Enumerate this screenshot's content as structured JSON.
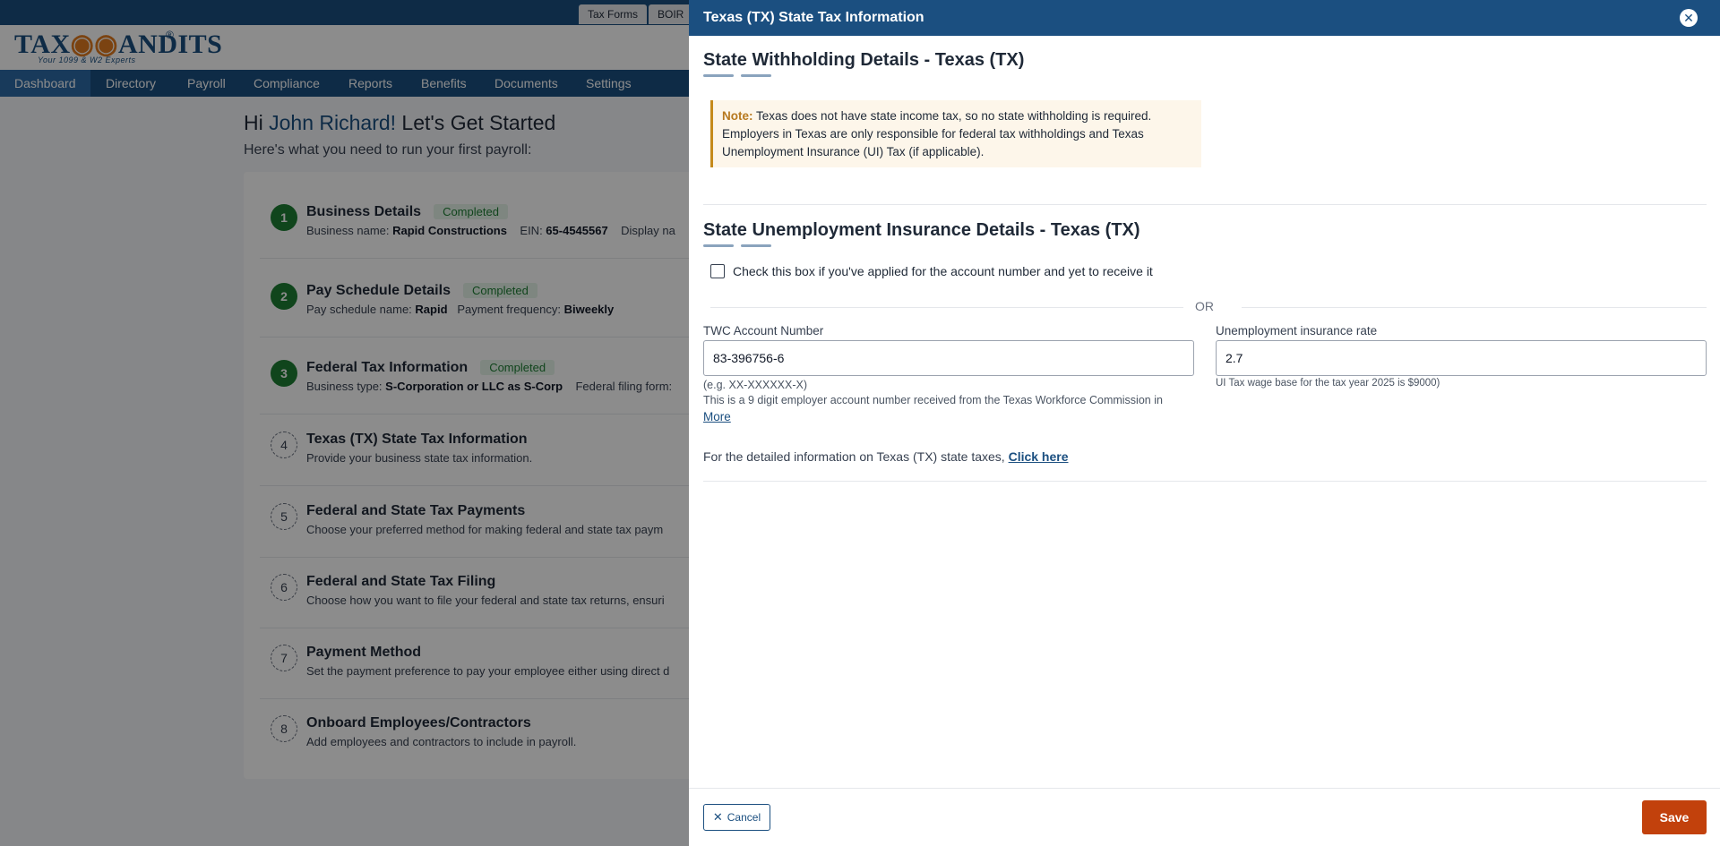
{
  "top_tabs": [
    "Tax Forms",
    "BOIR"
  ],
  "brand": {
    "logo_text_a": "TAX",
    "logo_text_owl": "◉◉",
    "logo_text_b": "ANDITS",
    "registered": "®",
    "tagline": "Your 1099 & W2 Experts"
  },
  "nav": [
    "Dashboard",
    "Directory",
    "Payroll",
    "Compliance",
    "Reports",
    "Benefits",
    "Documents",
    "Settings"
  ],
  "greeting": {
    "prefix": "Hi ",
    "name": "John Richard!",
    "suffix": " Let's Get Started",
    "subtitle": "Here's what you need to run your first payroll:"
  },
  "steps": [
    {
      "num": "1",
      "title": "Business Details",
      "badge": "Completed",
      "desc_parts": [
        [
          "Business name: ",
          ""
        ],
        [
          "Rapid Constructions",
          "b"
        ],
        [
          "    EIN: ",
          ""
        ],
        [
          "65-4545567",
          "b"
        ],
        [
          "    Display na",
          ""
        ]
      ]
    },
    {
      "num": "2",
      "title": "Pay Schedule Details",
      "badge": "Completed",
      "desc_parts": [
        [
          "Pay schedule name: ",
          ""
        ],
        [
          "Rapid",
          "b"
        ],
        [
          "   Payment frequency: ",
          ""
        ],
        [
          "Biweekly",
          "b"
        ]
      ]
    },
    {
      "num": "3",
      "title": "Federal Tax Information",
      "badge": "Completed",
      "desc_parts": [
        [
          "Business type: ",
          ""
        ],
        [
          "S-Corporation or LLC as S-Corp",
          "b"
        ],
        [
          "    Federal filing form:",
          ""
        ]
      ]
    },
    {
      "num": "4",
      "title": "Texas (TX) State Tax Information",
      "badge": "",
      "desc_parts": [
        [
          "Provide your business state tax information.",
          ""
        ]
      ]
    },
    {
      "num": "5",
      "title": "Federal and State Tax Payments",
      "badge": "",
      "desc_parts": [
        [
          "Choose your preferred method for making federal and state tax paym",
          ""
        ]
      ]
    },
    {
      "num": "6",
      "title": "Federal and State Tax Filing",
      "badge": "",
      "desc_parts": [
        [
          "Choose how you want to file your federal and state tax returns, ensuri",
          ""
        ]
      ]
    },
    {
      "num": "7",
      "title": "Payment Method",
      "badge": "",
      "desc_parts": [
        [
          "Set the payment preference to pay your employee either using direct d",
          ""
        ]
      ]
    },
    {
      "num": "8",
      "title": "Onboard Employees/Contractors",
      "badge": "",
      "desc_parts": [
        [
          "Add employees and contractors to include in payroll.",
          ""
        ]
      ]
    }
  ],
  "drawer": {
    "title": "Texas (TX) State Tax Information",
    "withholding_title": "State Withholding Details - Texas (TX)",
    "note_label": "Note:",
    "note_text": " Texas does not have state income tax, so no state withholding is required. Employers in Texas are only responsible for federal tax withholdings and Texas Unemployment Insurance (UI) Tax (if applicable).",
    "sui_title": "State Unemployment Insurance Details - Texas (TX)",
    "checkbox_label": "Check this box if you've applied for the account number and yet to receive it",
    "or_text": "OR",
    "twc_label": "TWC Account Number",
    "twc_value": "83-396756-6",
    "twc_example": "(e.g. XX-XXXXXX-X)",
    "twc_help": "This is a 9 digit employer account number received from the Texas Workforce Commission in",
    "more_link": "More",
    "ui_rate_label": "Unemployment insurance rate",
    "ui_rate_value": "2.7",
    "ui_rate_help": "UI Tax wage base for the tax year 2025 is $9000)",
    "detail_text": "For the detailed information on Texas (TX) state taxes, ",
    "detail_link": "Click here",
    "cancel_label": "Cancel",
    "save_label": "Save"
  }
}
